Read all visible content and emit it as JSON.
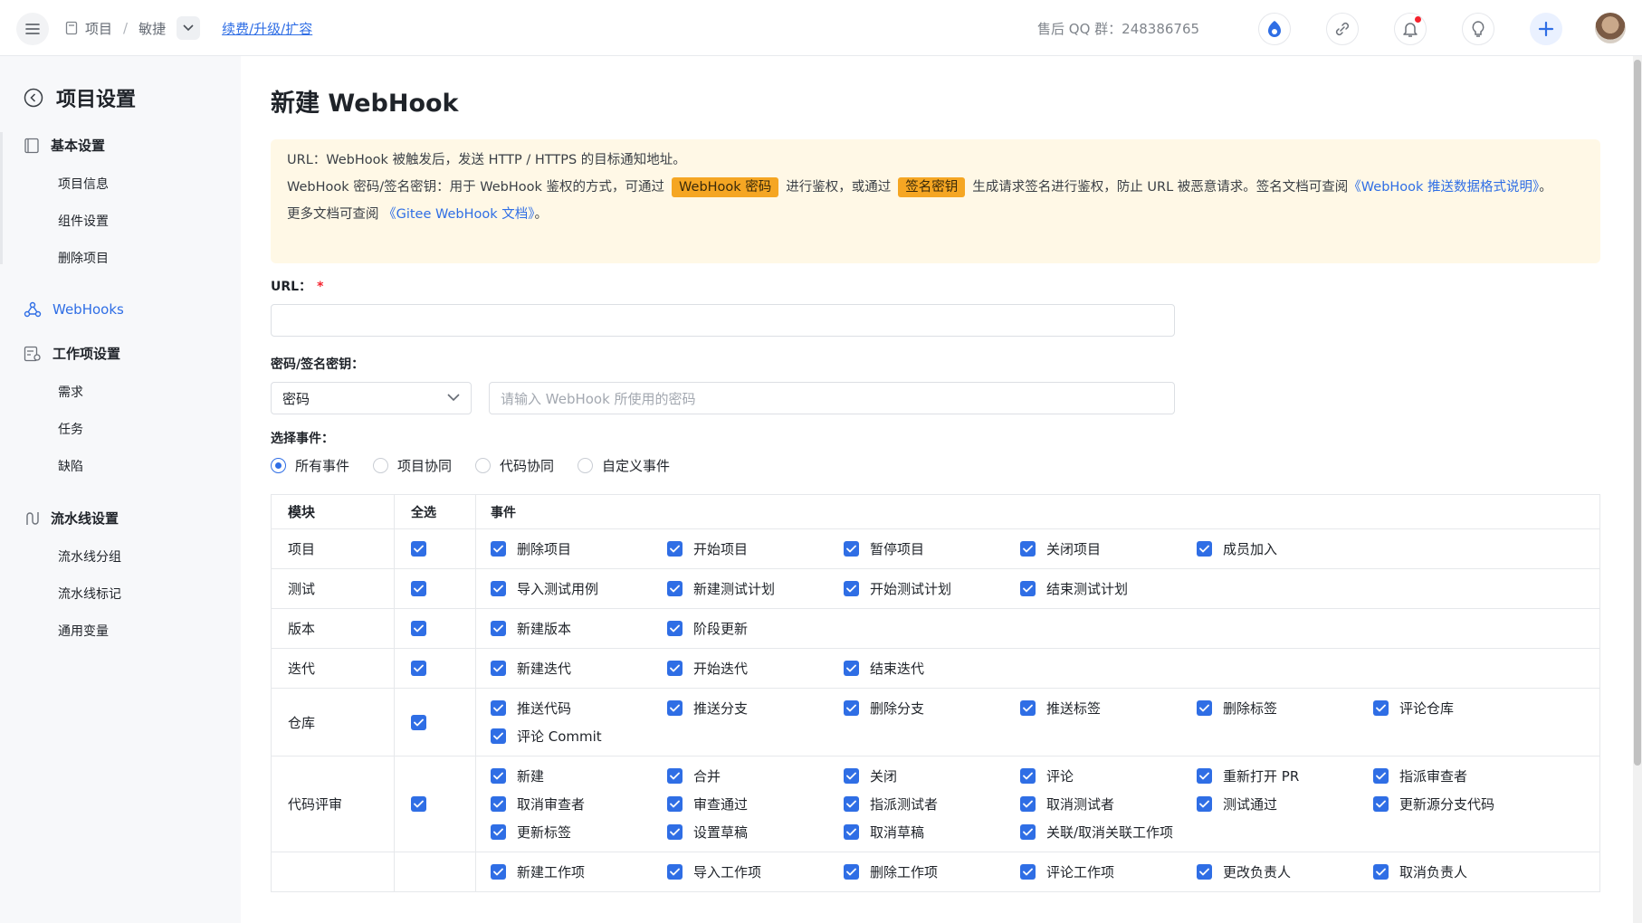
{
  "topbar": {
    "breadcrumb": [
      "项目",
      "敏捷"
    ],
    "renew_link": "续费/升级/扩容",
    "qq_label": "售后 QQ 群：248386765"
  },
  "sidebar": {
    "title": "项目设置",
    "groups": [
      {
        "label": "基本设置",
        "items": [
          "项目信息",
          "组件设置",
          "删除项目"
        ]
      },
      {
        "label": "WebHooks",
        "items": []
      },
      {
        "label": "工作项设置",
        "items": [
          "需求",
          "任务",
          "缺陷"
        ]
      },
      {
        "label": "流水线设置",
        "items": [
          "流水线分组",
          "流水线标记",
          "通用变量"
        ]
      }
    ]
  },
  "main": {
    "title": "新建 WebHook",
    "notice": {
      "line1": "URL：WebHook 被触发后，发送 HTTP / HTTPS 的目标通知地址。",
      "line2_a": "WebHook 密码/签名密钥：用于 WebHook 鉴权的方式，可通过",
      "tag1": "WebHook 密码",
      "line2_b": "进行鉴权，或通过",
      "tag2": "签名密钥",
      "line2_c": "生成请求签名进行鉴权，防止 URL 被恶意请求。签名文档可查阅",
      "link1": "《WebHook 推送数据格式说明》",
      "line2_end": "。",
      "line3_a": "更多文档可查阅",
      "link2": "《Gitee WebHook 文档》",
      "line3_end": "。"
    },
    "url_label": "URL：",
    "url_required": "*",
    "url_value": "",
    "secret_label": "密码/签名密钥：",
    "secret_type": "密码",
    "secret_placeholder": "请输入 WebHook 所使用的密码",
    "events_label": "选择事件：",
    "radios": [
      "所有事件",
      "项目协同",
      "代码协同",
      "自定义事件"
    ],
    "selected_radio": "所有事件",
    "table": {
      "headers": [
        "模块",
        "全选",
        "事件"
      ],
      "rows": [
        {
          "module": "项目",
          "events": [
            "删除项目",
            "开始项目",
            "暂停项目",
            "关闭项目",
            "成员加入"
          ]
        },
        {
          "module": "测试",
          "events": [
            "导入测试用例",
            "新建测试计划",
            "开始测试计划",
            "结束测试计划"
          ]
        },
        {
          "module": "版本",
          "events": [
            "新建版本",
            "阶段更新"
          ]
        },
        {
          "module": "迭代",
          "events": [
            "新建迭代",
            "开始迭代",
            "结束迭代"
          ]
        },
        {
          "module": "仓库",
          "events": [
            "推送代码",
            "推送分支",
            "删除分支",
            "推送标签",
            "删除标签",
            "评论仓库",
            "评论 Commit"
          ]
        },
        {
          "module": "代码评审",
          "events": [
            "新建",
            "合并",
            "关闭",
            "评论",
            "重新打开 PR",
            "指派审查者",
            "取消审查者",
            "审查通过",
            "指派测试者",
            "取消测试者",
            "测试通过",
            "更新源分支代码",
            "更新标签",
            "设置草稿",
            "取消草稿",
            "关联/取消关联工作项"
          ]
        },
        {
          "module": "",
          "events": [
            "新建工作项",
            "导入工作项",
            "删除工作项",
            "评论工作项",
            "更改负责人",
            "取消负责人"
          ]
        }
      ]
    }
  },
  "colors": {
    "accent": "#2f6ee5",
    "notice_bg": "#fff8e6",
    "tag_bg": "#f5a623"
  }
}
